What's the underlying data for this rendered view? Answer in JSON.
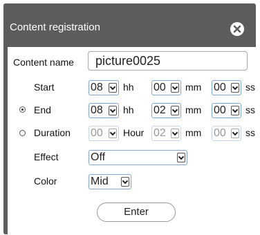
{
  "dialog": {
    "title": "Content registration",
    "close_icon": "close-icon"
  },
  "form": {
    "content_name_label": "Content name",
    "content_name_value": "picture0025",
    "start": {
      "label": "Start",
      "hh": "08",
      "hh_unit": "hh",
      "mm": "00",
      "mm_unit": "mm",
      "ss": "00",
      "ss_unit": "ss"
    },
    "end": {
      "label": "End",
      "selected": true,
      "hh": "08",
      "hh_unit": "hh",
      "mm": "02",
      "mm_unit": "mm",
      "ss": "00",
      "ss_unit": "ss"
    },
    "duration": {
      "label": "Duration",
      "selected": false,
      "hour": "00",
      "hour_unit": "Hour",
      "mm": "02",
      "mm_unit": "mm",
      "ss": "00",
      "ss_unit": "ss"
    },
    "effect": {
      "label": "Effect",
      "value": "Off"
    },
    "color": {
      "label": "Color",
      "value": "Mid"
    },
    "enter_label": "Enter"
  }
}
